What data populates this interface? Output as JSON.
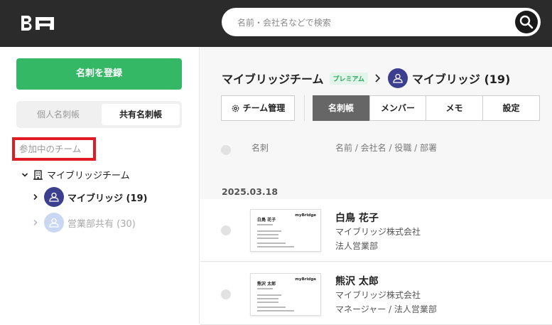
{
  "header": {
    "search_placeholder": "名前・会社名などで検索"
  },
  "sidebar": {
    "register_label": "名刺を登録",
    "tabs": [
      {
        "label": "個人名刺帳"
      },
      {
        "label": "共有名刺帳"
      }
    ],
    "section_label": "参加中のチーム",
    "team_name": "マイブリッジチーム",
    "groups": [
      {
        "label": "マイブリッジ (19)"
      },
      {
        "label": "営業部共有 (30)"
      }
    ]
  },
  "main": {
    "breadcrumb_team": "マイブリッジチーム",
    "premium_badge": "プレミアム",
    "breadcrumb_group": "マイブリッジ (19)",
    "team_manage_label": "チーム管理",
    "tabs": [
      {
        "label": "名刺帳"
      },
      {
        "label": "メンバー"
      },
      {
        "label": "メモ"
      },
      {
        "label": "設定"
      }
    ],
    "columns": {
      "card": "名刺",
      "info": "名前 / 会社名 / 役職 / 部署"
    },
    "date": "2025.03.18",
    "contacts": [
      {
        "name": "白鳥 花子",
        "company": "マイブリッジ株式会社",
        "role": "法人営業部",
        "card_name": "白鳥 花子",
        "card_brand": "myBridge"
      },
      {
        "name": "熊沢 太郎",
        "company": "マイブリッジ株式会社",
        "role": "マネージャー / 法人営業部",
        "card_name": "熊沢 太郎",
        "card_brand": "myBridge"
      }
    ]
  },
  "colors": {
    "accent_green": "#35b865",
    "avatar_active": "#3c3f8f",
    "avatar_inactive": "#c9d7f2",
    "highlight_red": "#e01b24",
    "topbar": "#2b2b2b"
  }
}
